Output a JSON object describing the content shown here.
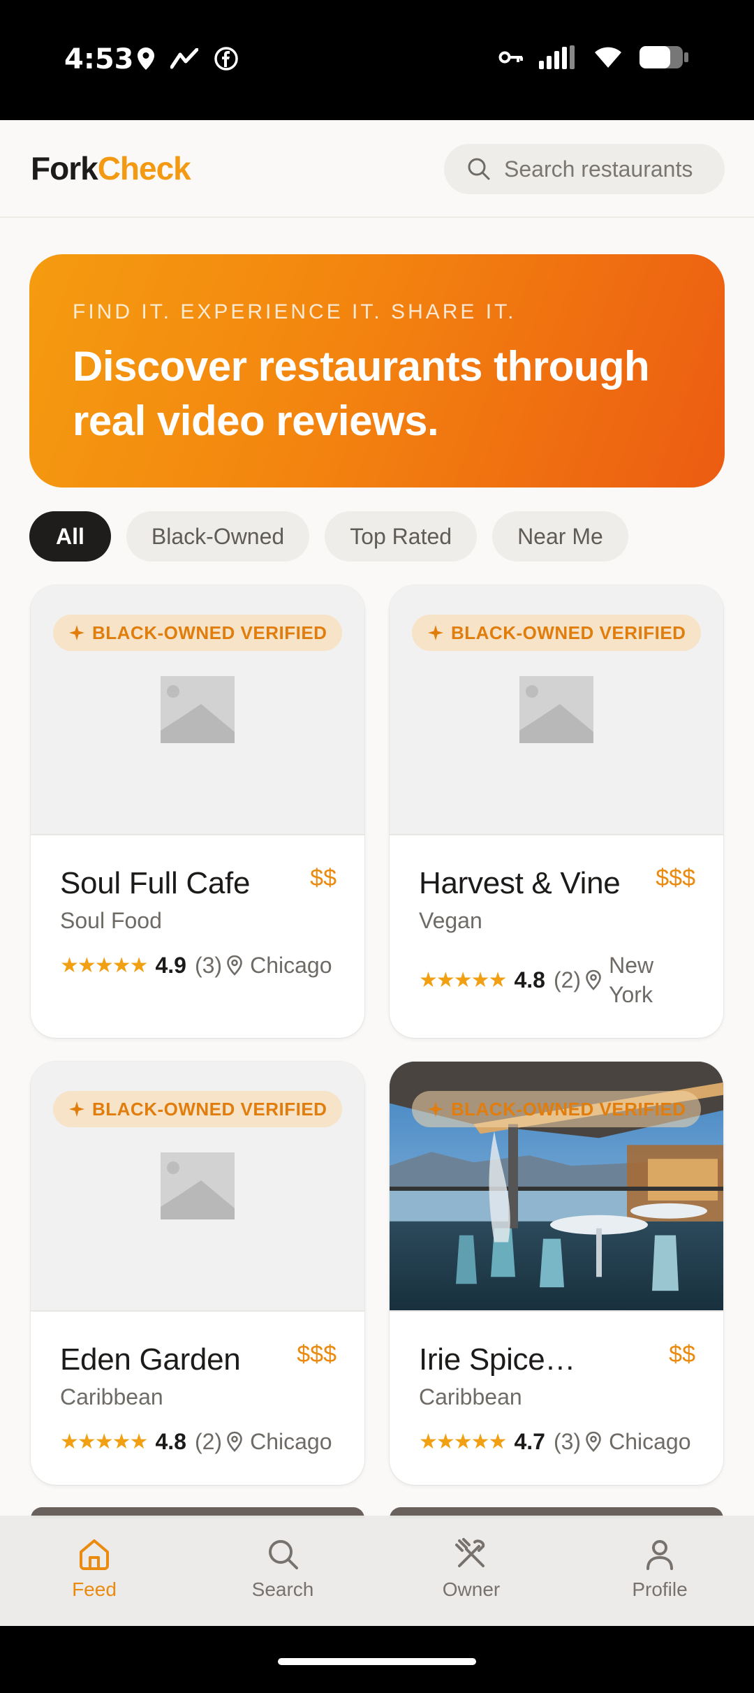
{
  "status_bar": {
    "time": "4:53",
    "left_icons": [
      "location-icon",
      "activity-icon",
      "facebook-icon"
    ],
    "right_icons": [
      "key-icon",
      "signal-icon",
      "wifi-icon",
      "battery-icon"
    ]
  },
  "header": {
    "logo_part1": "Fork",
    "logo_part2": "Check",
    "search_placeholder": "Search restaurants"
  },
  "hero": {
    "tagline": "FIND IT. EXPERIENCE IT. SHARE IT.",
    "title": "Discover restaurants through real video reviews."
  },
  "filters": [
    "All",
    "Black-Owned",
    "Top Rated",
    "Near Me"
  ],
  "active_filter": "All",
  "badge_label": "BLACK-OWNED VERIFIED",
  "restaurants": [
    {
      "name": "Soul Full Cafe",
      "price": "$$",
      "cuisine": "Soul Food",
      "stars": "★★★★★",
      "rating": "4.9",
      "reviews": "(3)",
      "city": "Chicago",
      "image": "placeholder"
    },
    {
      "name": "Harvest & Vine",
      "price": "$$$",
      "cuisine": "Vegan",
      "stars": "★★★★★",
      "rating": "4.8",
      "reviews": "(2)",
      "city": "New York",
      "image": "placeholder"
    },
    {
      "name": "Eden Garden",
      "price": "$$$",
      "cuisine": "Caribbean",
      "stars": "★★★★★",
      "rating": "4.8",
      "reviews": "(2)",
      "city": "Chicago",
      "image": "placeholder"
    },
    {
      "name": "Irie Spice…",
      "price": "$$",
      "cuisine": "Caribbean",
      "stars": "★★★★★",
      "rating": "4.7",
      "reviews": "(3)",
      "city": "Chicago",
      "image": "patio-photo"
    }
  ],
  "bottom_nav": [
    {
      "label": "Feed",
      "icon": "home-icon",
      "active": true
    },
    {
      "label": "Search",
      "icon": "search-icon",
      "active": false
    },
    {
      "label": "Owner",
      "icon": "fork-knife-icon",
      "active": false
    },
    {
      "label": "Profile",
      "icon": "user-icon",
      "active": false
    }
  ],
  "colors": {
    "accent": "#f39a12",
    "hero_start": "#f59c10",
    "hero_end": "#ec5c12",
    "badge_bg": "#f7e3c7"
  }
}
